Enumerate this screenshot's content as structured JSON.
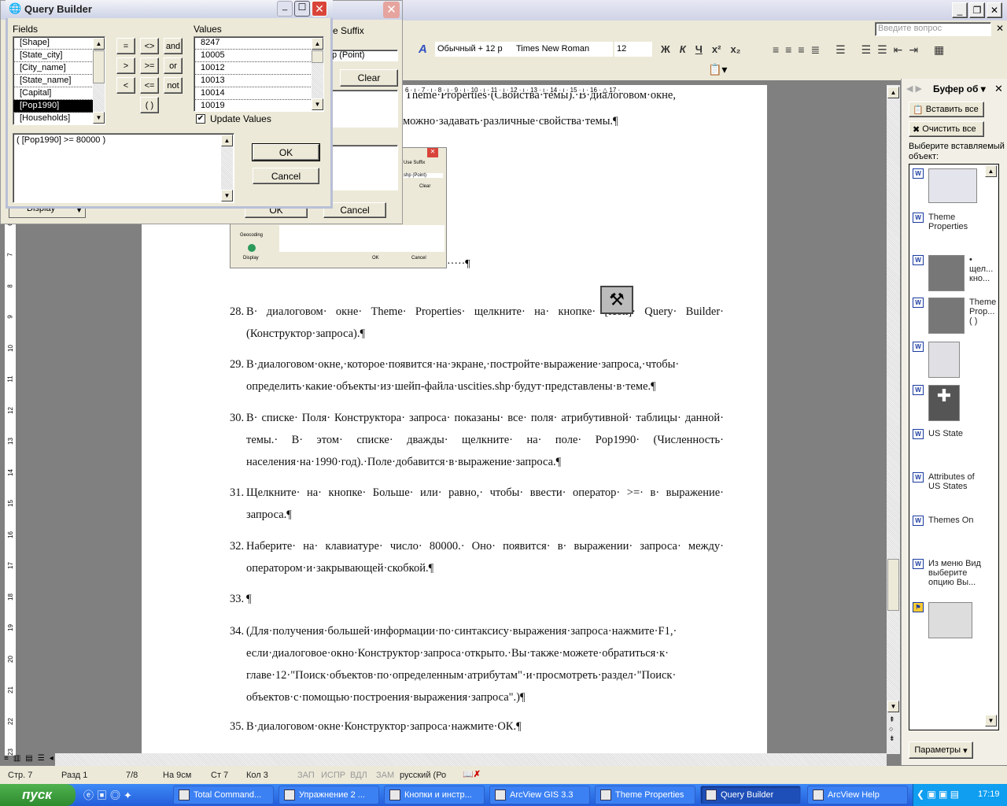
{
  "word": {
    "help_placeholder": "Введите вопрос",
    "style": "Обычный + 12 р",
    "font": "Times New Roman",
    "size": "12",
    "fmt": [
      "Ж",
      "К",
      "Ч",
      "x²",
      "x₂"
    ],
    "ruler": "6 · ı · 7 · ı · 8 · ı · 9 · ı · 10 · ı · 11 · ı · 12 · ı · 13 · ı · 14 · ı · 15 · ı · 16 · △ 17 ·",
    "vruler": [
      "6",
      "7",
      "8",
      "9",
      "10",
      "11",
      "12",
      "13",
      "14",
      "15",
      "16",
      "17",
      "18",
      "19",
      "20",
      "21",
      "22",
      "23"
    ]
  },
  "doc": {
    "top_cut": "Theme·Properties·(Свойства·темы).·В·диалоговом·окне,",
    "top_line": "можно·задавать·различные·свойства·темы.¶",
    "img_pilcrow": "·····¶",
    "paragraphs": [
      {
        "n": "28.",
        "t": "В· диалоговом· окне· Theme· Properties· щелкните· на· кнопке· [icon]· Query· Builder· (Конструктор·запроса).¶"
      },
      {
        "n": "29.",
        "t": "В·диалоговом·окне,·которое·появится·на·экране,·постройте·выражение·запроса,·чтобы· определить·какие·объекты·из·шейп-файла·uscities.shp·будут·представлены·в·теме.¶"
      },
      {
        "n": "30.",
        "t": "В· списке· Поля· Конструктора· запроса· показаны· все· поля· атрибутивной· таблицы· данной· темы.· В· этом· списке· дважды· щелкните· на· поле· Pop1990· (Численность· населения·на·1990·год).·Поле·добавится·в·выражение·запроса.¶"
      },
      {
        "n": "31.",
        "t": "Щелкните· на· кнопке· Больше· или· равно,· чтобы· ввести· оператор· >=· в· выражение· запроса.¶"
      },
      {
        "n": "32.",
        "t": "Наберите· на· клавиатуре· число· 80000.· Оно· появится· в· выражении· запроса· между· оператором·и·закрывающей·скобкой.¶"
      },
      {
        "n": "33.",
        "t": "¶"
      },
      {
        "n": "34.",
        "t": "(Для·получения·большей·информации·по·синтаксису·выражения·запроса·нажмите·F1,· если·диалоговое·окно·Конструктор·запроса·открыто.·Вы·также·можете·обратиться·к· главе·12·\"Поиск·объектов·по·определенным·атрибутам\"·и·просмотреть·раздел·\"Поиск· объектов·с·помощью·построения·выражения·запроса\".)¶"
      },
      {
        "n": "35.",
        "t": "В·диалоговом·окне·Конструктор·запроса·нажмите·ОК.¶"
      }
    ],
    "embedded": {
      "use_suffix": "Use Suffix",
      "shp": "shp (Point)",
      "clear": "Clear",
      "geocoding": "Geocoding",
      "display": "Display",
      "ok": "OK",
      "cancel": "Cancel"
    }
  },
  "taskpane": {
    "title": "Буфер об",
    "paste_all": "Вставить все",
    "clear_all": "Очистить все",
    "prompt": "Выберите вставляемый объект:",
    "items": [
      "Theme Properties",
      "• щел... кно...",
      "Theme Prop... ( )",
      "US State",
      "Attributes of US States",
      "Themes On",
      "Из меню Вид выберите опцию Вы..."
    ],
    "options": "Параметры"
  },
  "theme_props": {
    "suffix": "e Suffix",
    "input": "p (Point)",
    "clear": "Clear",
    "ok": "OK",
    "cancel": "Cancel",
    "display": "Display"
  },
  "qb": {
    "title": "Query Builder",
    "fields_label": "Fields",
    "fields": [
      "[Shape]",
      "[State_city]",
      "[City_name]",
      "[State_name]",
      "[Capital]",
      "[Pop1990]",
      "[Households]"
    ],
    "selected_field": "[Pop1990]",
    "ops": [
      "=",
      "<>",
      "and",
      ">",
      ">=",
      "or",
      "<",
      "<=",
      "not",
      "( )"
    ],
    "values_label": "Values",
    "values": [
      "8247",
      "10005",
      "10012",
      "10013",
      "10014",
      "10019"
    ],
    "update_values": "Update Values",
    "update_checked": true,
    "expression": "( [Pop1990] >= 80000 )",
    "ok": "OK",
    "cancel": "Cancel"
  },
  "status": {
    "page": "Стр. 7",
    "section": "Разд 1",
    "pages": "7/8",
    "at": "На 9см",
    "line": "Ст 7",
    "col": "Кол 3",
    "rec": "ЗАП",
    "trk": "ИСПР",
    "ext": "ВДЛ",
    "ovr": "ЗАМ",
    "lang": "русский (Ро"
  },
  "taskbar": {
    "start": "пуск",
    "tasks": [
      "Total Command...",
      "Упражнение 2 ...",
      "Кнопки и инстр...",
      "ArcView GIS 3.3",
      "Theme Properties",
      "Query Builder",
      "ArcView Help"
    ],
    "active": "Query Builder",
    "clock": "17:19"
  }
}
